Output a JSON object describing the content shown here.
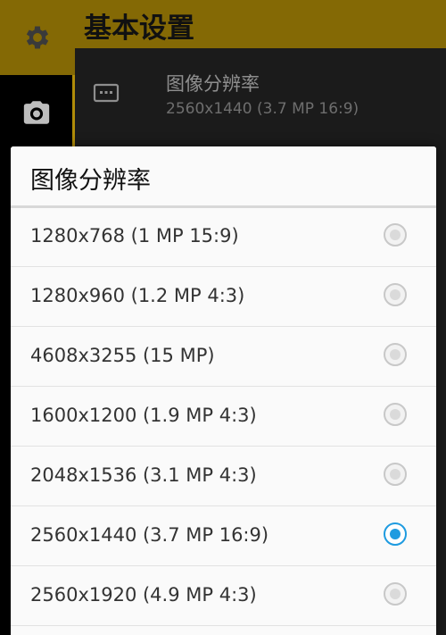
{
  "header": {
    "title": "基本设置"
  },
  "rail": {
    "items": [
      {
        "icon": "gear-icon"
      },
      {
        "icon": "camera-icon"
      }
    ]
  },
  "background_list": {
    "items": [
      {
        "icon": "screen-icon",
        "title": "图像分辨率",
        "subtitle": "2560x1440 (3.7 MP 16:9)"
      }
    ]
  },
  "dialog": {
    "title": "图像分辨率",
    "options": [
      {
        "label": "1280x768 (1 MP 15:9)",
        "selected": false
      },
      {
        "label": "1280x960 (1.2 MP 4:3)",
        "selected": false
      },
      {
        "label": "4608x3255 (15 MP)",
        "selected": false
      },
      {
        "label": "1600x1200 (1.9 MP 4:3)",
        "selected": false
      },
      {
        "label": "2048x1536 (3.1 MP 4:3)",
        "selected": false
      },
      {
        "label": "2560x1440 (3.7 MP 16:9)",
        "selected": true
      },
      {
        "label": "2560x1920 (4.9 MP 4:3)",
        "selected": false
      }
    ]
  },
  "colors": {
    "accent": "#846905",
    "radio_selected": "#1e9be0"
  }
}
